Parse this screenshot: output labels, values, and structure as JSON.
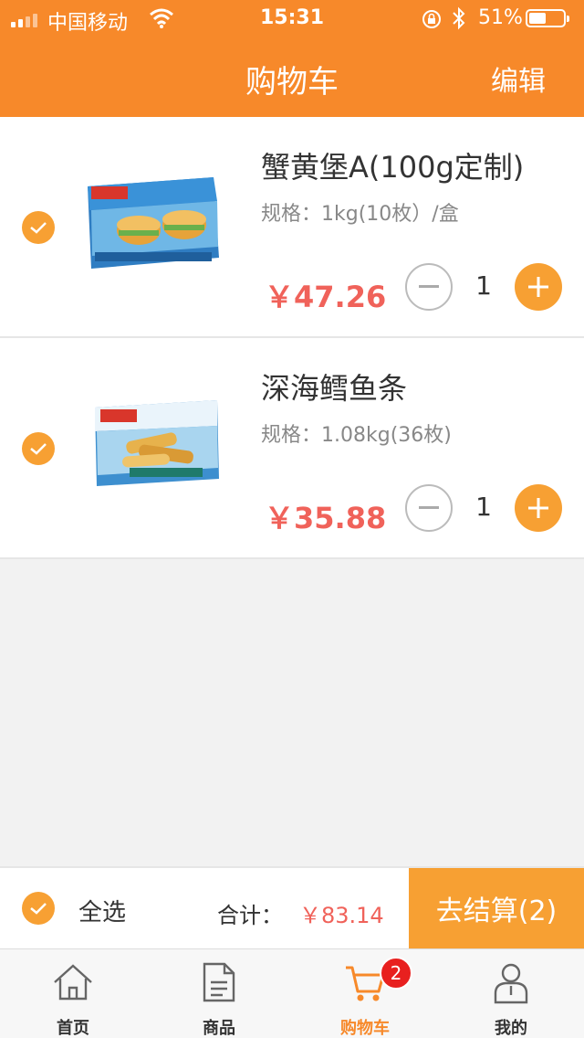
{
  "status_bar": {
    "carrier": "中国移动",
    "time": "15:31",
    "battery_percent_text": "51%",
    "battery_level": 0.51
  },
  "nav": {
    "title": "购物车",
    "edit_label": "编辑"
  },
  "cart": {
    "items": [
      {
        "name": "蟹黄堡A(100g定制)",
        "spec": "规格：1kg(10枚）/盒",
        "price": "￥47.26",
        "quantity": "1",
        "checked": true
      },
      {
        "name": "深海鳕鱼条",
        "spec": "规格：1.08kg(36枚)",
        "price": "￥35.88",
        "quantity": "1",
        "checked": true
      }
    ]
  },
  "checkout": {
    "select_all_label": "全选",
    "total_label": "合计：",
    "total_value": "￥83.14",
    "checkout_label": "去结算(2)"
  },
  "tabbar": {
    "tabs": [
      {
        "label": "首页",
        "icon": "home-icon"
      },
      {
        "label": "商品",
        "icon": "document-icon"
      },
      {
        "label": "购物车",
        "icon": "cart-icon",
        "badge": "2",
        "active": true
      },
      {
        "label": "我的",
        "icon": "user-icon"
      }
    ]
  },
  "colors": {
    "accent": "#f7892a",
    "button": "#f7a033",
    "price": "#f0625a",
    "badge": "#e8201f"
  }
}
